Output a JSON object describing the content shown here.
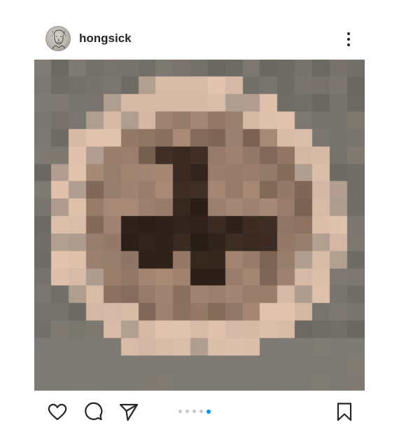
{
  "post": {
    "username": "hongsick",
    "avatar_icon": "sketch-portrait-avatar",
    "more_icon": "vertical-ellipsis-icon",
    "image_description_icon": "pixelated-photo",
    "carousel": {
      "total": 5,
      "active_index": 4,
      "active_color": "#0095f6",
      "inactive_color": "#c7c7c7"
    }
  },
  "actions": {
    "like_icon": "heart-icon",
    "comment_icon": "comment-icon",
    "share_icon": "paper-plane-icon",
    "save_icon": "bookmark-icon"
  }
}
